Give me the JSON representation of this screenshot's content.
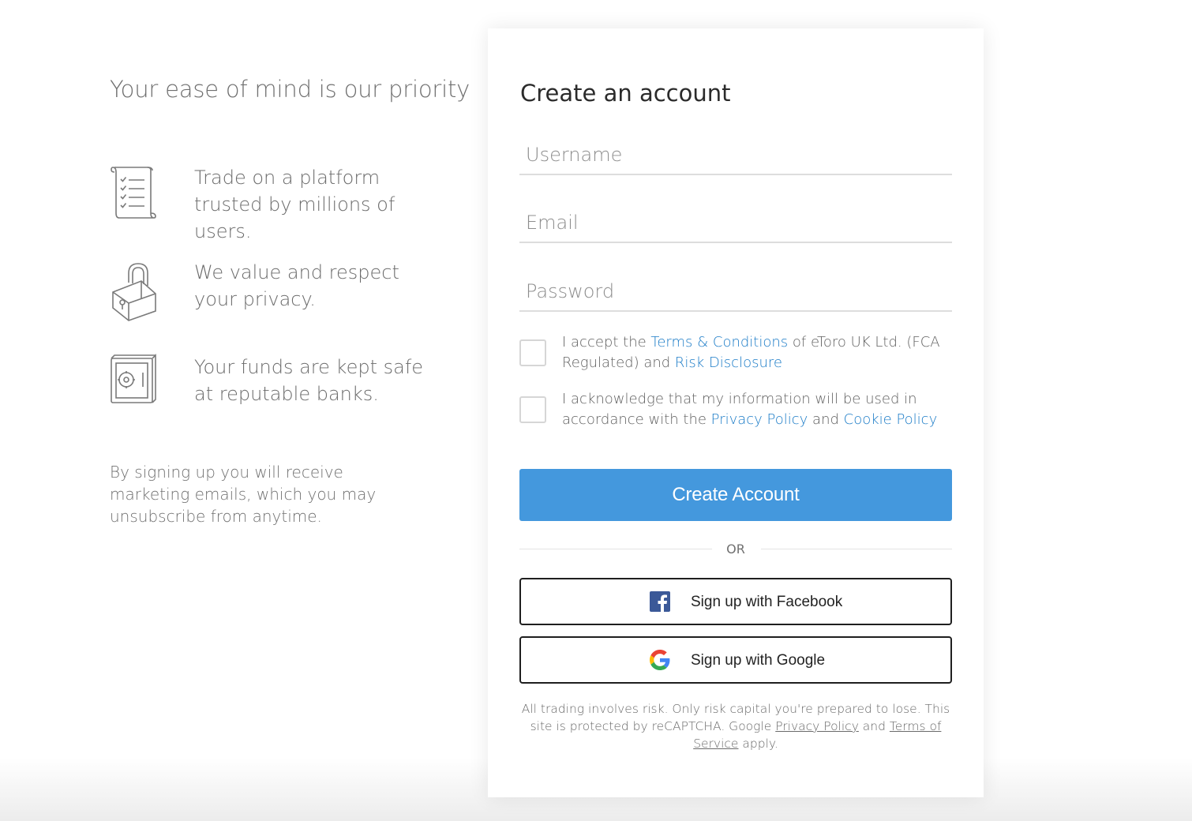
{
  "left_panel": {
    "heading": "Your ease of mind is our priority",
    "features": [
      {
        "icon": "checklist-scroll-icon",
        "text": "Trade on a platform trusted by millions of users."
      },
      {
        "icon": "padlock-icon",
        "text": "We value and respect your privacy."
      },
      {
        "icon": "safe-icon",
        "text": "Your funds are kept safe at reputable banks."
      }
    ],
    "marketing_note": "By signing up you will receive marketing emails, which you may unsubscribe from anytime."
  },
  "form": {
    "title": "Create an account",
    "username": {
      "placeholder": "Username",
      "value": ""
    },
    "email": {
      "placeholder": "Email",
      "value": ""
    },
    "password": {
      "placeholder": "Password",
      "value": ""
    },
    "terms": {
      "checked": false,
      "prefix": "I accept the ",
      "link1": "Terms & Conditions",
      "middle": " of eToro UK Ltd. (FCA Regulated) and ",
      "link2": "Risk Disclosure"
    },
    "privacy": {
      "checked": false,
      "prefix": "I acknowledge that my information will be used in accordance with the ",
      "link1": "Privacy Policy",
      "middle": " and ",
      "link2": "Cookie Policy"
    },
    "submit_label": "Create Account",
    "or_label": "OR",
    "facebook_label": "Sign up with Facebook",
    "google_label": "Sign up with Google",
    "disclaimer": {
      "text1": "All trading involves risk. Only risk capital you're prepared to lose. This site is protected by reCAPTCHA. Google ",
      "link1": "Privacy Policy",
      "and": " and ",
      "link2": "Terms of Service",
      "text2": " apply."
    }
  },
  "colors": {
    "primary_button": "#4498dd",
    "link": "#1a7bc7",
    "facebook": "#3b5998"
  }
}
